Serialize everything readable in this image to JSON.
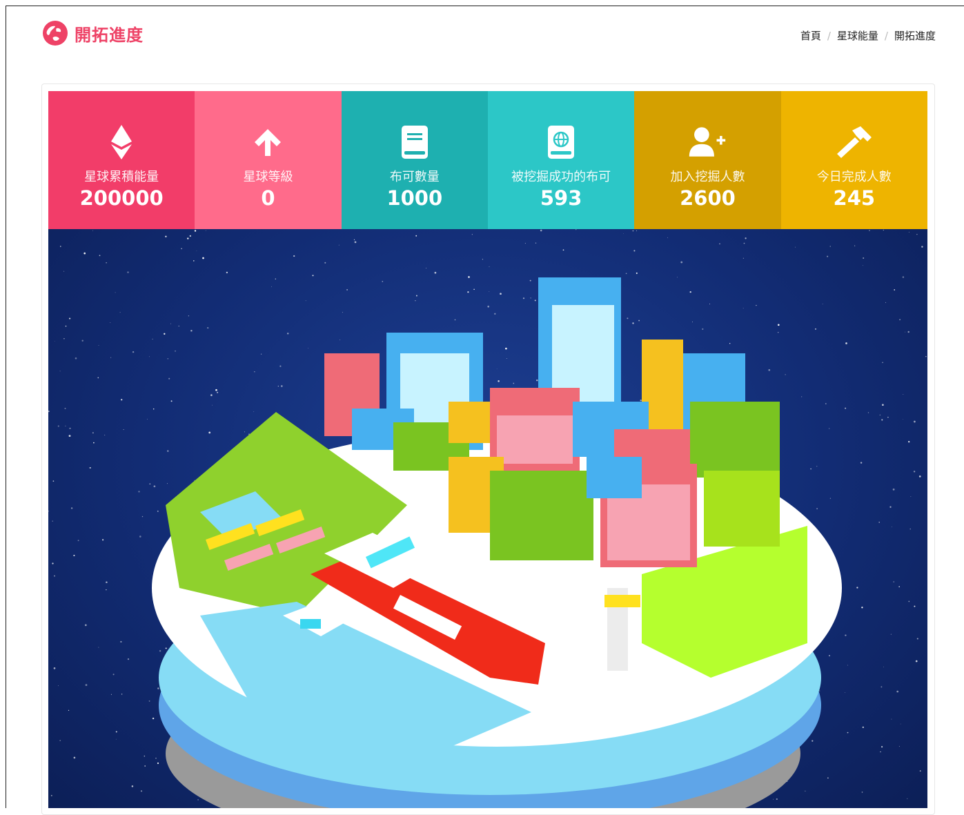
{
  "page": {
    "title": "開拓進度",
    "logo_icon": "globe-icon",
    "accent_color": "#ee4266"
  },
  "breadcrumb": {
    "items": [
      "首頁",
      "星球能量",
      "開拓進度"
    ],
    "separator": "/"
  },
  "stats": [
    {
      "icon": "ethereum-icon",
      "label": "星球累積能量",
      "value": "200000",
      "color": "#f23d69"
    },
    {
      "icon": "arrow-up-icon",
      "label": "星球等級",
      "value": "0",
      "color": "#ff6b8b"
    },
    {
      "icon": "book-icon",
      "label": "布可數量",
      "value": "1000",
      "color": "#1eb0b0"
    },
    {
      "icon": "globe-book-icon",
      "label": "被挖掘成功的布可",
      "value": "593",
      "color": "#2cc7c7"
    },
    {
      "icon": "user-plus-icon",
      "label": "加入挖掘人數",
      "value": "2600",
      "color": "#d4a000"
    },
    {
      "icon": "hammer-icon",
      "label": "今日完成人數",
      "value": "245",
      "color": "#eeb400"
    }
  ],
  "scene": {
    "description_icon": "voxel-planet-city-image"
  }
}
